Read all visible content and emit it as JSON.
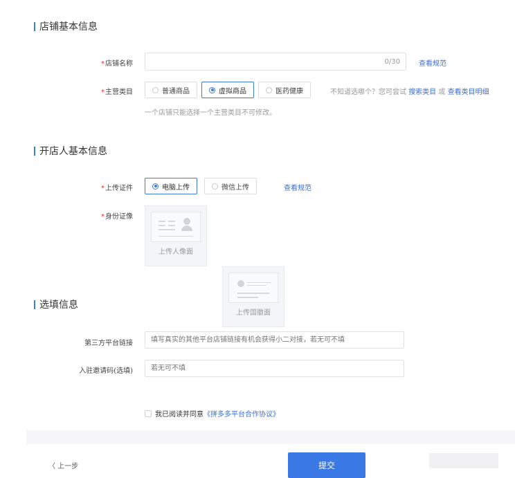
{
  "sections": {
    "store_basic": "店铺基本信息",
    "owner_basic": "开店人基本信息",
    "optional": "选填信息"
  },
  "store_name": {
    "label": "店铺名称",
    "required_mark": "*",
    "counter": "0/30",
    "rules_link": "查看规范"
  },
  "main_category": {
    "label": "主营类目",
    "required_mark": "*",
    "options": [
      "普通商品",
      "虚拟商品",
      "医药健康"
    ],
    "selected_index": 1,
    "hint_prefix": "不知道选哪个？您可尝试",
    "search_link": "搜索类目",
    "or_text": "或",
    "detail_link": "查看类目明细",
    "note": "一个店铺只能选择一个主营类目不可修改。"
  },
  "upload_cert": {
    "label": "上传证件",
    "required_mark": "*",
    "options": [
      "电脑上传",
      "微信上传"
    ],
    "selected_index": 0,
    "rules_link": "查看规范"
  },
  "id_photo": {
    "label": "身份证像",
    "required_mark": "*",
    "front_caption": "上传人像面",
    "back_caption": "上传国徽面"
  },
  "third_party_link": {
    "label": "第三方平台链接",
    "placeholder": "填写真实的其他平台店铺链接有机会获得小二对接，若无可不填"
  },
  "invite_code": {
    "label": "入驻邀请码(选填)",
    "placeholder": "若无可不填"
  },
  "agreement": {
    "prefix": "我已阅读并同意",
    "link": "《拼多多平台合作协议》"
  },
  "footer": {
    "back": "〈 上一步",
    "submit": "提交"
  },
  "colors": {
    "accent": "#3d7bd9",
    "submit": "#3a78e6",
    "required": "#e02e24"
  }
}
